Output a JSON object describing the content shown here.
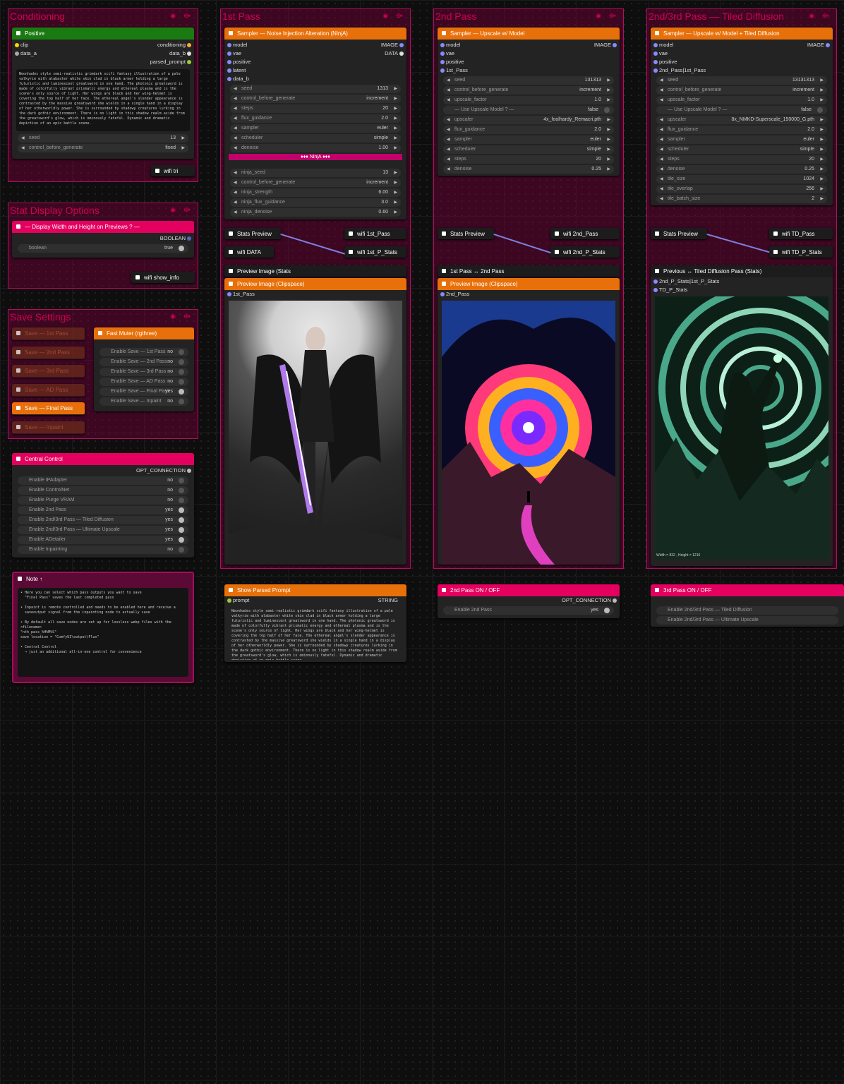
{
  "groups": {
    "conditioning": "Conditioning",
    "stat": "Stat Display Options",
    "save": "Save Settings",
    "pass1": "1st Pass",
    "pass2": "2nd Pass",
    "pass3": "2nd/3rd Pass — Tiled Diffusion"
  },
  "icons": {
    "group": "eye-icon",
    "wifi": "wifi-icon"
  },
  "positive": {
    "title": "Positive",
    "in1": "clip",
    "in2": "data_a",
    "out1": "conditioning",
    "out2": "data_b",
    "out3": "parsed_prompt",
    "prompt": "Neonhades style semi-realistic grimdark scifi fantasy illustration of a pale valkyrie with alabaster white skin clad in black armor holding a large futuristic and luminescent greatsword in one hand. The photonic greatsword is made of colorfully vibrant prismatic energy and ethereal plasma and is the scene's only source of light. Her wings are black and her wing-helmet is covering the top half of her face. The ethereal angel's slender appearance is contrasted by the massive greatsword she wields in a single hand in a display of her otherworldly power. She is surrounded by shadowy creatures lurking in the dark gothic environment. There is no light in this shadow realm aside from the greatsword's glow, which is ominously fateful. Dynamic and dramatic depiction of an epic battle scene.",
    "seed_l": "seed",
    "seed_v": "13",
    "cbg_l": "control_before_generate",
    "cbg_v": "fixed"
  },
  "wifi_tri": "wifi tri",
  "display": {
    "title": "— Display Width and Height on Previews ? —",
    "out": "BOOLEAN",
    "w_l": "boolean",
    "w_v": "true"
  },
  "wifi_show": "wifi show_info",
  "save_nodes": [
    "Save — 1st Pass",
    "Save — 2nd Pass",
    "Save — 3rd Pass",
    "Save — AD Pass",
    "Save — Final Pass",
    "Save — Inpaint"
  ],
  "muter": {
    "title": "Fast Muter (rgthree)",
    "rows": [
      [
        "Enable Save — 1st Pass",
        "no"
      ],
      [
        "Enable Save — 2nd Pass",
        "no"
      ],
      [
        "Enable Save — 3rd Pass",
        "no"
      ],
      [
        "Enable Save — AD Pass",
        "no"
      ],
      [
        "Enable Save — Final Pass",
        "yes"
      ],
      [
        "Enable Save — Inpaint",
        "no"
      ]
    ]
  },
  "central": {
    "title": "Central Control",
    "out": "OPT_CONNECTION",
    "rows": [
      [
        "Enable IPAdapter",
        "no"
      ],
      [
        "Enable ControlNet",
        "no"
      ],
      [
        "Enable Purge VRAM",
        "no"
      ],
      [
        "Enable 2nd Pass",
        "yes"
      ],
      [
        "Enable 2nd/3rd Pass — Tiled Diffusion",
        "yes"
      ],
      [
        "Enable 2nd/3rd Pass — Ultimate Upscale",
        "yes"
      ],
      [
        "Enable ADetailer",
        "yes"
      ],
      [
        "Enable Inpainting",
        "no"
      ]
    ]
  },
  "note": {
    "title": "Note ↑",
    "text": "• Here you can select which pass outputs you want to save\n  \"Final Pass\" saves the last completed pass\n\n• Inpaint is remote controlled and needs to be enabled here and receive a\n  saveoutput signal from the inpainting node to actually save\n\n• By default all save nodes are set up for lossless webp files with the <filename>\n\"nth_pass_%H%M%S\"\nsave location = \"ComfyUI\\output\\Flux\"\n\n• Central Control\n  → just an additional all-in-one control for convenience"
  },
  "s1": {
    "title": "Sampler — Noise Injection Alteration (NinjA)",
    "ins": [
      "model",
      "vae",
      "positive",
      "latent",
      "data_b"
    ],
    "out1": "IMAGE",
    "out2": "DATA",
    "w": [
      [
        "seed",
        "1313"
      ],
      [
        "control_before_generate",
        "increment"
      ],
      [
        "steps",
        "20"
      ],
      [
        "flux_guidance",
        "2.0"
      ],
      [
        "sampler",
        "euler"
      ],
      [
        "scheduler",
        "simple"
      ],
      [
        "denoise",
        "1.00"
      ]
    ],
    "banner": "♦♦♦ NinjA ♦♦♦",
    "w2": [
      [
        "ninja_seed",
        "13"
      ],
      [
        "control_before_generate",
        "increment"
      ],
      [
        "ninja_strength",
        "6.00"
      ],
      [
        "ninja_flux_guidance",
        "3.0"
      ],
      [
        "ninja_denoise",
        "0.60"
      ]
    ]
  },
  "s2": {
    "title": "Sampler — Upscale w/ Model",
    "ins": [
      "model",
      "vae",
      "positive",
      "1st_Pass"
    ],
    "out1": "IMAGE",
    "w": [
      [
        "seed",
        "131313"
      ],
      [
        "control_before_generate",
        "increment"
      ],
      [
        "upscale_factor",
        "1.0"
      ],
      [
        "— Use Upscale Model ? —",
        "false"
      ],
      [
        "upscaler",
        "4x_foolhardy_Remacri.pth"
      ],
      [
        "flux_guidance",
        "2.0"
      ],
      [
        "sampler",
        "euler"
      ],
      [
        "scheduler",
        "simple"
      ],
      [
        "steps",
        "20"
      ],
      [
        "denoise",
        "0.25"
      ]
    ]
  },
  "s3": {
    "title": "Sampler — Upscale w/ Model + Tiled Diffusion",
    "ins": [
      "model",
      "vae",
      "positive",
      "2nd_Pass|1st_Pass"
    ],
    "out1": "IMAGE",
    "w": [
      [
        "seed",
        "13131313"
      ],
      [
        "control_before_generate",
        "increment"
      ],
      [
        "upscale_factor",
        "1.0"
      ],
      [
        "— Use Upscale Model ? —",
        "false"
      ],
      [
        "upscaler",
        "8x_NMKD-Superscale_150000_G.pth"
      ],
      [
        "flux_guidance",
        "2.0"
      ],
      [
        "sampler",
        "euler"
      ],
      [
        "scheduler",
        "simple"
      ],
      [
        "steps",
        "20"
      ],
      [
        "denoise",
        "0.25"
      ],
      [
        "tile_size",
        "1024"
      ],
      [
        "tile_overlap",
        "256"
      ],
      [
        "tile_batch_size",
        "2"
      ]
    ]
  },
  "stats_preview": "Stats Preview",
  "wifi": {
    "p1a": "wifi 1st_Pass",
    "p1b": "wifi 1st_P_Stats",
    "p1c": "wifi DATA",
    "p2a": "wifi 2nd_Pass",
    "p2b": "wifi 2nd_P_Stats",
    "p3a": "wifi TD_Pass",
    "p3b": "wifi TD_P_Stats"
  },
  "prev1": {
    "stats": "Preview Image (Stats",
    "clip": "Preview Image (Clipspace)",
    "in": "1st_Pass"
  },
  "prev2": {
    "stats": "1st Pass ↔ 2nd Pass",
    "clip": "Preview Image (Clipspace)",
    "in": "2nd_Pass"
  },
  "prev3": {
    "stats": "Previous ↔ Tiled Diffusion Pass (Stats)",
    "in1": "2nd_P_Stats|1st_P_Stats",
    "in2": "TD_P_Stats",
    "caption": "Width = 832 , Height = 1216"
  },
  "spp": {
    "title": "Show Parsed Prompt",
    "in": "prompt",
    "out": "STRING"
  },
  "p2sw": {
    "title": "2nd Pass  ON / OFF",
    "out": "OPT_CONNECTION",
    "row": [
      "Enable 2nd Pass",
      "yes"
    ]
  },
  "p3sw": {
    "title": "3rd Pass  ON / OFF",
    "rows": [
      "Enable 2nd/3rd Pass — Tiled Diffusion",
      "Enable 2nd/3rd Pass — Ultimate Upscale"
    ]
  }
}
